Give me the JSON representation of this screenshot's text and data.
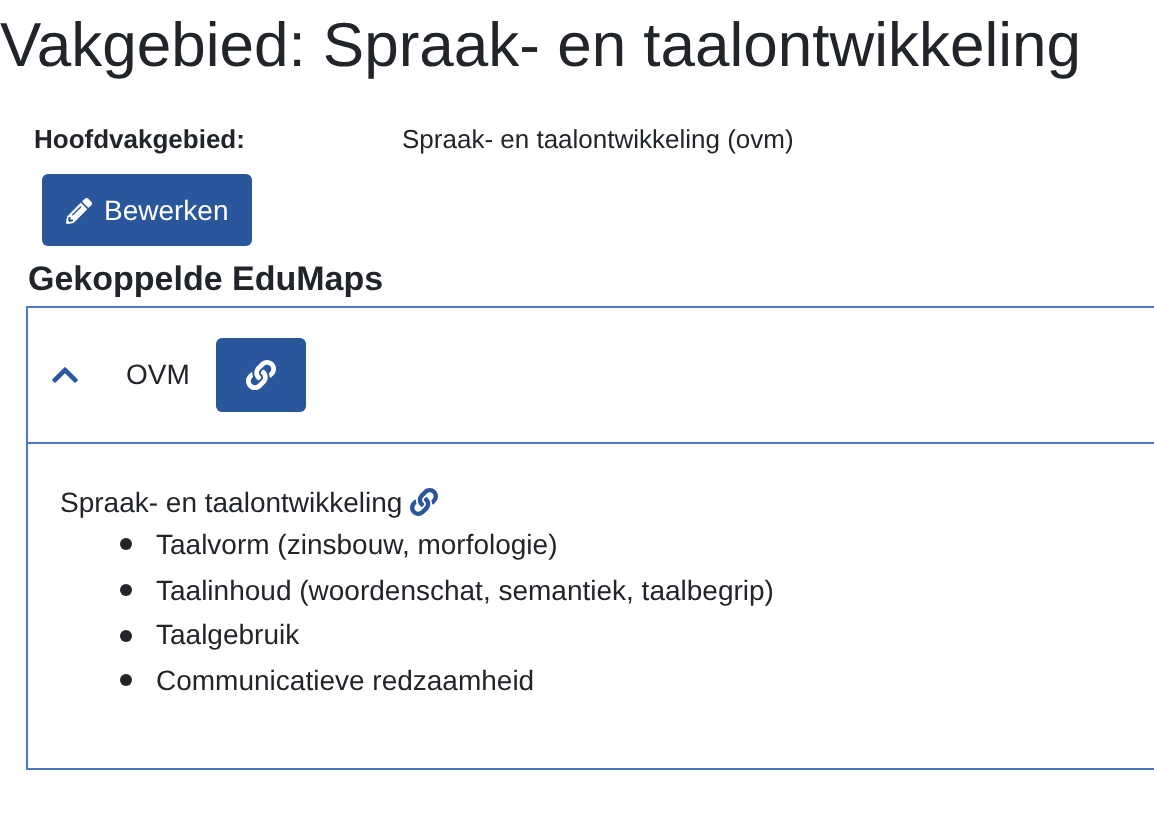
{
  "title": "Vakgebied: Spraak- en taalontwikkeling",
  "fields": [
    {
      "label": "Hoofdvakgebied:",
      "value": "Spraak- en taalontwikkeling (ovm)"
    }
  ],
  "edit_button": {
    "label": "Bewerken"
  },
  "section_heading": "Gekoppelde EduMaps",
  "edumaps": [
    {
      "name": "OVM",
      "expanded": true,
      "topic": "Spraak- en taalontwikkeling",
      "items": [
        "Taalvorm (zinsbouw, morfologie)",
        "Taalinhoud (woordenschat, semantiek, taalbegrip)",
        "Taalgebruik",
        "Communicatieve redzaamheid"
      ]
    }
  ]
}
